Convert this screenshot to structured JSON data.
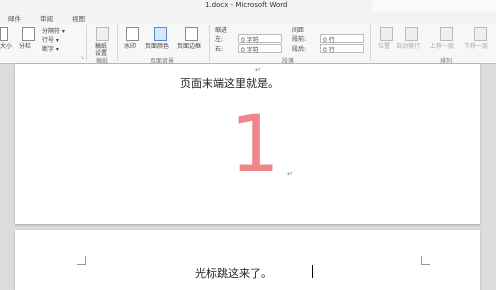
{
  "window": {
    "title": "1.docx - Microsoft Word"
  },
  "tabs": [
    "邮件",
    "审阅",
    "视图"
  ],
  "ribbon": {
    "page_setup": {
      "size": "大小",
      "columns": "分栏",
      "breaks": "分隔符 ▾",
      "line_numbers": "行号 ▾",
      "hyphenation": "断字 ▾",
      "group_label": ""
    },
    "draft": {
      "label1": "稿纸",
      "label2": "设置",
      "group_label": "稿纸"
    },
    "page_background": {
      "watermark": "水印",
      "page_color": "页面颜色",
      "page_borders": "页面边框",
      "group_label": "页面背景"
    },
    "paragraph": {
      "indent_header": "缩进",
      "indent_left_label": "左:",
      "indent_left_value": "0 字符",
      "indent_right_label": "右:",
      "indent_right_value": "0 字符",
      "spacing_header": "间距",
      "spacing_before_label": "段前:",
      "spacing_before_value": "0 行",
      "spacing_after_label": "段后:",
      "spacing_after_value": "0 行",
      "group_label": "段落"
    },
    "arrange": {
      "position": "位置",
      "wrap_text": "自动换行",
      "bring_forward": "上移一层",
      "send_backward": "下移一层",
      "group_label": "排列"
    }
  },
  "document": {
    "page1_text": "页面末端这里就是。",
    "page1_big_number": "1",
    "page2_text": "光标跳这来了。"
  },
  "colors": {
    "big_number": "#f0868c"
  }
}
